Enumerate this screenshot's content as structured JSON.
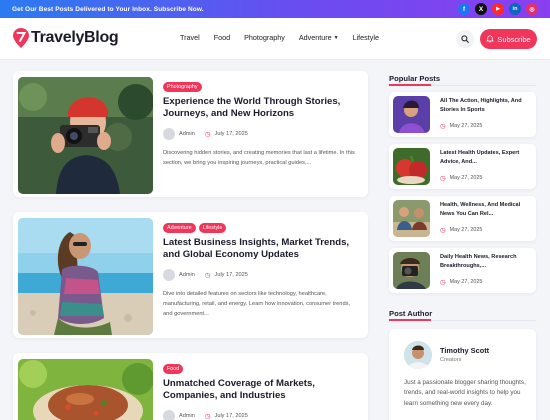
{
  "topbar": {
    "announcement": "Get Our Best Posts Delivered to Your Inbox. Subscribe Now.",
    "socials": [
      {
        "icon": "facebook-icon",
        "glyph": "f",
        "color": "#1877f2"
      },
      {
        "icon": "x-icon",
        "glyph": "X",
        "color": "#111111"
      },
      {
        "icon": "youtube-icon",
        "glyph": "▶",
        "color": "#ff2a2a"
      },
      {
        "icon": "linkedin-icon",
        "glyph": "in",
        "color": "#0a66c2"
      },
      {
        "icon": "instagram-icon",
        "glyph": "◎",
        "color": "#e1306c"
      }
    ]
  },
  "header": {
    "logo": "TravelyBlog",
    "nav": [
      "Travel",
      "Food",
      "Photography",
      "Adventure",
      "Lifestyle"
    ],
    "subscribe_label": "Subscribe"
  },
  "posts": [
    {
      "tags": [
        "Photography"
      ],
      "title": "Experience the World Through Stories, Journeys, and New Horizons",
      "author": "Admin",
      "date": "July 17, 2025",
      "excerpt": "Discovering hidden stories, and creating memories that last a lifetime. In this section, we bring you inspiring journeys, practical guides,..."
    },
    {
      "tags": [
        "Adventure",
        "Lifestyle"
      ],
      "title": "Latest Business Insights, Market Trends, and Global Economy Updates",
      "author": "Admin",
      "date": "July 17, 2025",
      "excerpt": "Dive into detailed features on sectors like technology, healthcare, manufacturing, retail, and energy. Learn how innovation, consumer trends, and government..."
    },
    {
      "tags": [
        "Food"
      ],
      "title": "Unmatched Coverage of Markets, Companies, and Industries",
      "author": "Admin",
      "date": "July 17, 2025",
      "excerpt": ""
    }
  ],
  "sidebar": {
    "popular_heading": "Popular Posts",
    "popular": [
      {
        "title": "All The Action, Highlights, And Stories In Sports",
        "date": "May 27, 2025"
      },
      {
        "title": "Latest Health Updates, Expert Advice, And...",
        "date": "May 27, 2025"
      },
      {
        "title": "Health, Wellness, And Medical News You Can Rel...",
        "date": "May 27, 2025"
      },
      {
        "title": "Daily Health News, Research Breakthroughs,...",
        "date": "May 27, 2025"
      }
    ],
    "author_heading": "Post Author",
    "author": {
      "name": "Timothy Scott",
      "role": "Creators",
      "bio": "Just a passionate blogger sharing thoughts, trends, and real-world insights to help you learn something new every day."
    }
  },
  "colors": {
    "accent": "#f0365a",
    "topbar_start": "#2b7bf0",
    "topbar_end": "#8a3ff0"
  }
}
